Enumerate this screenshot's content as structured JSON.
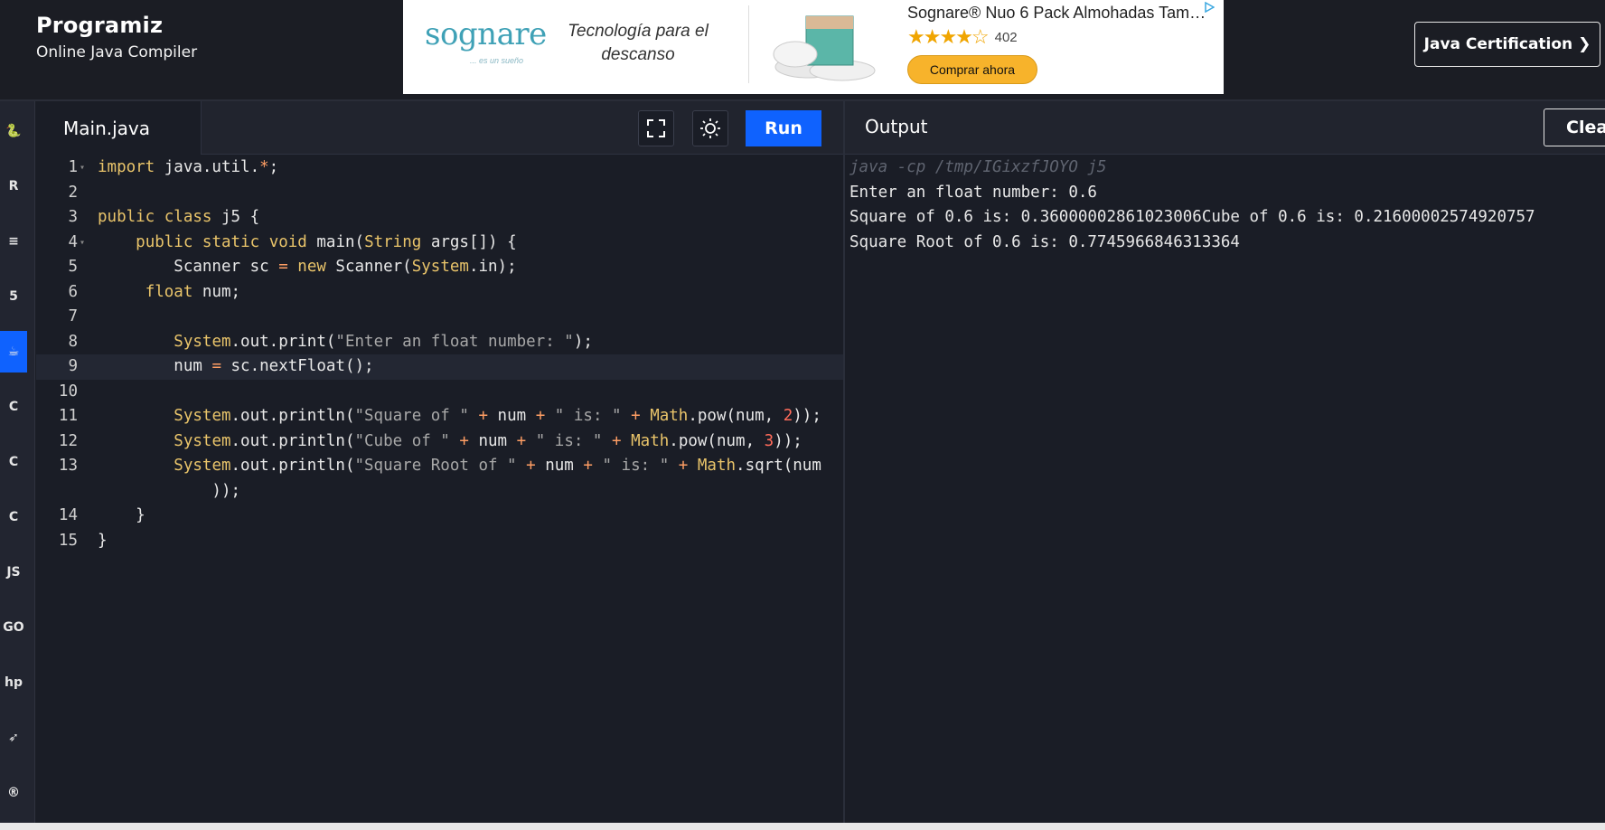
{
  "header": {
    "logo": "Programiz",
    "subtitle": "Online Java Compiler",
    "certification_button": "Java Certification ❯"
  },
  "ad": {
    "brand": "sognare",
    "brand_tagline": "... es un sueño",
    "tagline": "Tecnología para el descanso",
    "product_title": "Sognare® Nuo 6 Pack Almohadas Tama…",
    "stars": "★★★★☆",
    "rating_count": "402",
    "buy_button": "Comprar ahora"
  },
  "sidebar": {
    "items": [
      {
        "name": "python",
        "glyph": "🐍"
      },
      {
        "name": "r",
        "glyph": "R"
      },
      {
        "name": "sql",
        "glyph": "≡"
      },
      {
        "name": "html",
        "glyph": "5"
      },
      {
        "name": "java",
        "glyph": "☕",
        "active": true
      },
      {
        "name": "c",
        "glyph": "C"
      },
      {
        "name": "cpp",
        "glyph": "C"
      },
      {
        "name": "csharp",
        "glyph": "C"
      },
      {
        "name": "js",
        "glyph": "JS"
      },
      {
        "name": "go",
        "glyph": "GO"
      },
      {
        "name": "php",
        "glyph": "hp"
      },
      {
        "name": "swift",
        "glyph": "➶"
      },
      {
        "name": "rust",
        "glyph": "®"
      }
    ]
  },
  "editor": {
    "file_tab": "Main.java",
    "run_label": "Run",
    "lines": [
      {
        "n": "1",
        "code": "import java.util.*;"
      },
      {
        "n": "2",
        "code": ""
      },
      {
        "n": "3",
        "code": "public class j5 {"
      },
      {
        "n": "4",
        "code": "    public static void main(String args[]) {"
      },
      {
        "n": "5",
        "code": "        Scanner sc = new Scanner(System.in);"
      },
      {
        "n": "6",
        "code": "     float num;"
      },
      {
        "n": "7",
        "code": ""
      },
      {
        "n": "8",
        "code": "        System.out.print(\"Enter an float number: \");"
      },
      {
        "n": "9",
        "code": "        num = sc.nextFloat();"
      },
      {
        "n": "10",
        "code": ""
      },
      {
        "n": "11",
        "code": "        System.out.println(\"Square of \" + num + \" is: \" + Math.pow(num, 2));"
      },
      {
        "n": "12",
        "code": "        System.out.println(\"Cube of \" + num + \" is: \" + Math.pow(num, 3));"
      },
      {
        "n": "13",
        "code": "        System.out.println(\"Square Root of \" + num + \" is: \" + Math.sqrt(num"
      },
      {
        "n": "",
        "code": "            ));"
      },
      {
        "n": "14",
        "code": "    }"
      },
      {
        "n": "15",
        "code": "}"
      }
    ]
  },
  "output": {
    "title": "Output",
    "clear_label": "Clear",
    "lines": [
      "java -cp /tmp/IGixzfJOYO j5",
      "Enter an float number: 0.6",
      "Square of 0.6 is: 0.36000002861023006Cube of 0.6 is: 0.21600002574920757",
      "Square Root of 0.6 is: 0.7745966846313364"
    ]
  }
}
